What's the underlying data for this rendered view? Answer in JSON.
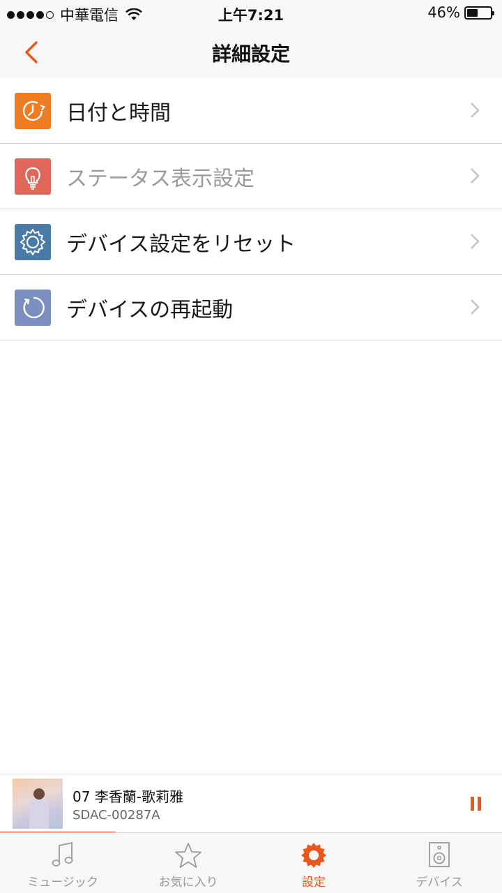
{
  "status_bar": {
    "carrier": "中華電信",
    "time": "上午7:21",
    "battery_percent": "46%",
    "battery_level": 0.46
  },
  "nav": {
    "title": "詳細設定",
    "back_icon": "chevron-left-icon"
  },
  "settings": {
    "items": [
      {
        "label": "日付と時間",
        "icon": "clock-icon",
        "color": "#f07c22",
        "enabled": true
      },
      {
        "label": "ステータス表示設定",
        "icon": "lightbulb-icon",
        "color": "#e0685a",
        "enabled": false
      },
      {
        "label": "デバイス設定をリセット",
        "icon": "gear-icon",
        "color": "#4a7ba8",
        "enabled": true
      },
      {
        "label": "デバイスの再起動",
        "icon": "restart-icon",
        "color": "#7a8fc0",
        "enabled": true
      }
    ]
  },
  "now_playing": {
    "title": "07 李香蘭-歌莉雅",
    "subtitle": "SDAC-00287A",
    "progress": 0.23
  },
  "tabs": [
    {
      "label": "ミュージック",
      "icon": "music-note-icon",
      "active": false
    },
    {
      "label": "お気に入り",
      "icon": "star-icon",
      "active": false
    },
    {
      "label": "設定",
      "icon": "gear-icon",
      "active": true
    },
    {
      "label": "デバイス",
      "icon": "speaker-icon",
      "active": false
    }
  ],
  "colors": {
    "accent": "#e8581a",
    "chevron": "#c4c4c6",
    "disabled_text": "#9a9a9a"
  }
}
